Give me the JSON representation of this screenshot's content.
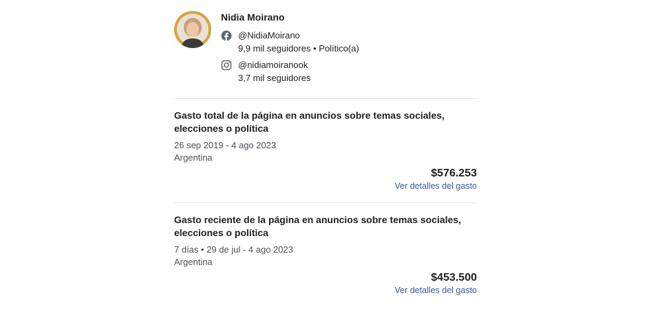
{
  "profile": {
    "name": "Nidia Moirano",
    "facebook": {
      "icon": "facebook-icon",
      "handle": "@NidiaMoirano",
      "details": "9,9 mil seguidores • Político(a)"
    },
    "instagram": {
      "icon": "instagram-icon",
      "handle": "@nidiamoiranook",
      "details": "3,7 mil seguidores"
    }
  },
  "total_spend": {
    "title": "Gasto total de la página en anuncios sobre temas sociales, elecciones o política",
    "dates": "26 sep 2019 - 4 ago 2023",
    "country": "Argentina",
    "amount": "$576.253",
    "link": "Ver detalles del gasto"
  },
  "recent_spend": {
    "title": "Gasto reciente de la página en anuncios sobre temas sociales, elecciones o política",
    "dates": "7 días • 29 de jul - 4 ago 2023",
    "country": "Argentina",
    "amount": "$453.500",
    "link": "Ver detalles del gasto"
  },
  "colors": {
    "link": "#385898",
    "divider": "#e4e6eb",
    "text": "#1c1e21",
    "avatar_ring": "#d9a23a"
  }
}
